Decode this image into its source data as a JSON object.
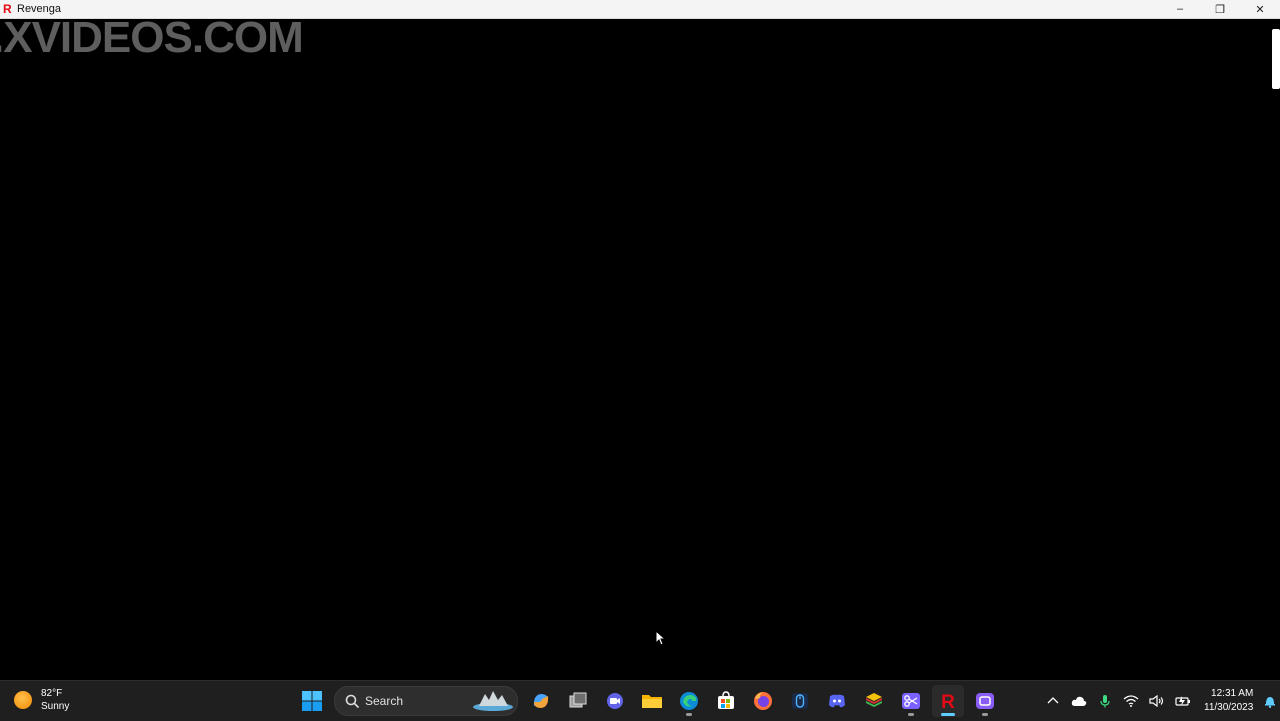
{
  "window": {
    "title": "Revenga",
    "logo_letter": "R",
    "controls": {
      "minimize": "–",
      "maximize": "❐",
      "close": "✕"
    }
  },
  "content": {
    "watermark_text": ".XVIDEOS.COM"
  },
  "taskbar": {
    "weather": {
      "temp": "82°F",
      "condition": "Sunny"
    },
    "search_label": "Search",
    "pinned": [
      {
        "name": "start-button",
        "icon": "windows-logo-icon"
      },
      {
        "name": "copilot",
        "icon": "copilot-icon"
      },
      {
        "name": "task-view",
        "icon": "task-view-icon"
      },
      {
        "name": "teams-chat",
        "icon": "chat-icon"
      },
      {
        "name": "file-explorer",
        "icon": "folder-icon"
      },
      {
        "name": "edge",
        "icon": "edge-icon"
      },
      {
        "name": "ms-store",
        "icon": "store-icon"
      },
      {
        "name": "firefox",
        "icon": "firefox-icon"
      },
      {
        "name": "mouse-app",
        "icon": "mouse-icon"
      },
      {
        "name": "discord",
        "icon": "discord-icon"
      },
      {
        "name": "bluestacks",
        "icon": "bluestacks-icon"
      },
      {
        "name": "snipping-tool",
        "icon": "scissors-icon"
      },
      {
        "name": "revenga",
        "icon": "revenga-icon"
      },
      {
        "name": "app-purple",
        "icon": "app-icon"
      }
    ],
    "tray": {
      "time": "12:31 AM",
      "date": "11/30/2023"
    }
  },
  "colors": {
    "accent": "#60cdff",
    "brand_red": "#e50914",
    "taskbar_bg": "#1f1f1f"
  }
}
